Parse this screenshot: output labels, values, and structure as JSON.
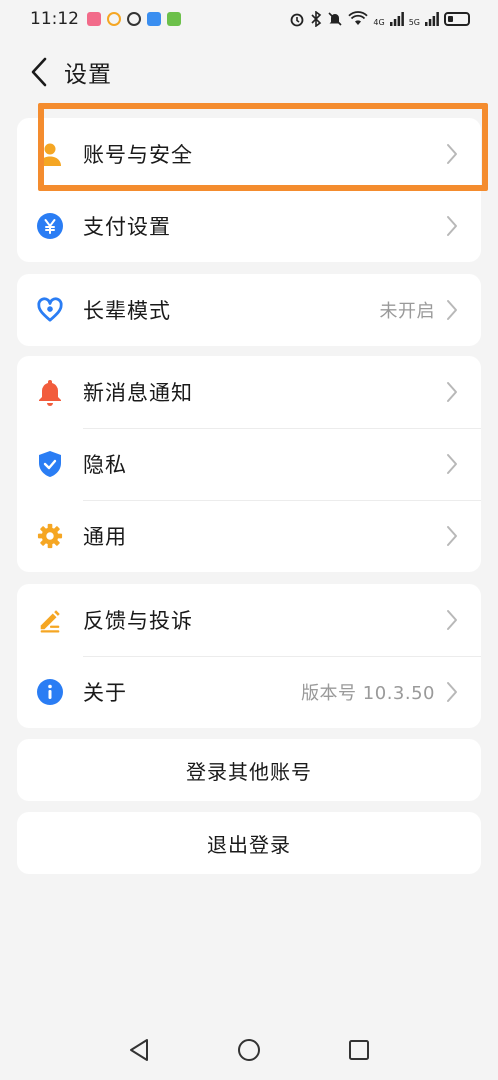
{
  "status_bar": {
    "time": "11:12",
    "network_4g": "4G",
    "network_5g": "5G",
    "icons": [
      "alarm-icon",
      "bluetooth-icon",
      "mute-icon",
      "wifi-icon",
      "signal-icon",
      "battery-icon"
    ]
  },
  "header": {
    "title": "设置"
  },
  "groups": {
    "account": {
      "account_security": "账号与安全",
      "payment_settings": "支付设置"
    },
    "elder": {
      "elder_mode": "长辈模式",
      "elder_mode_value": "未开启"
    },
    "general": {
      "notifications": "新消息通知",
      "privacy": "隐私",
      "general": "通用"
    },
    "about": {
      "feedback": "反馈与投诉",
      "about": "关于",
      "version_value": "版本号 10.3.50"
    }
  },
  "actions": {
    "login_other": "登录其他账号",
    "logout": "退出登录"
  },
  "colors": {
    "blue": "#2a7df4",
    "orange": "#f5a623",
    "red": "#f25c3c",
    "highlight": "#f48c2e"
  }
}
